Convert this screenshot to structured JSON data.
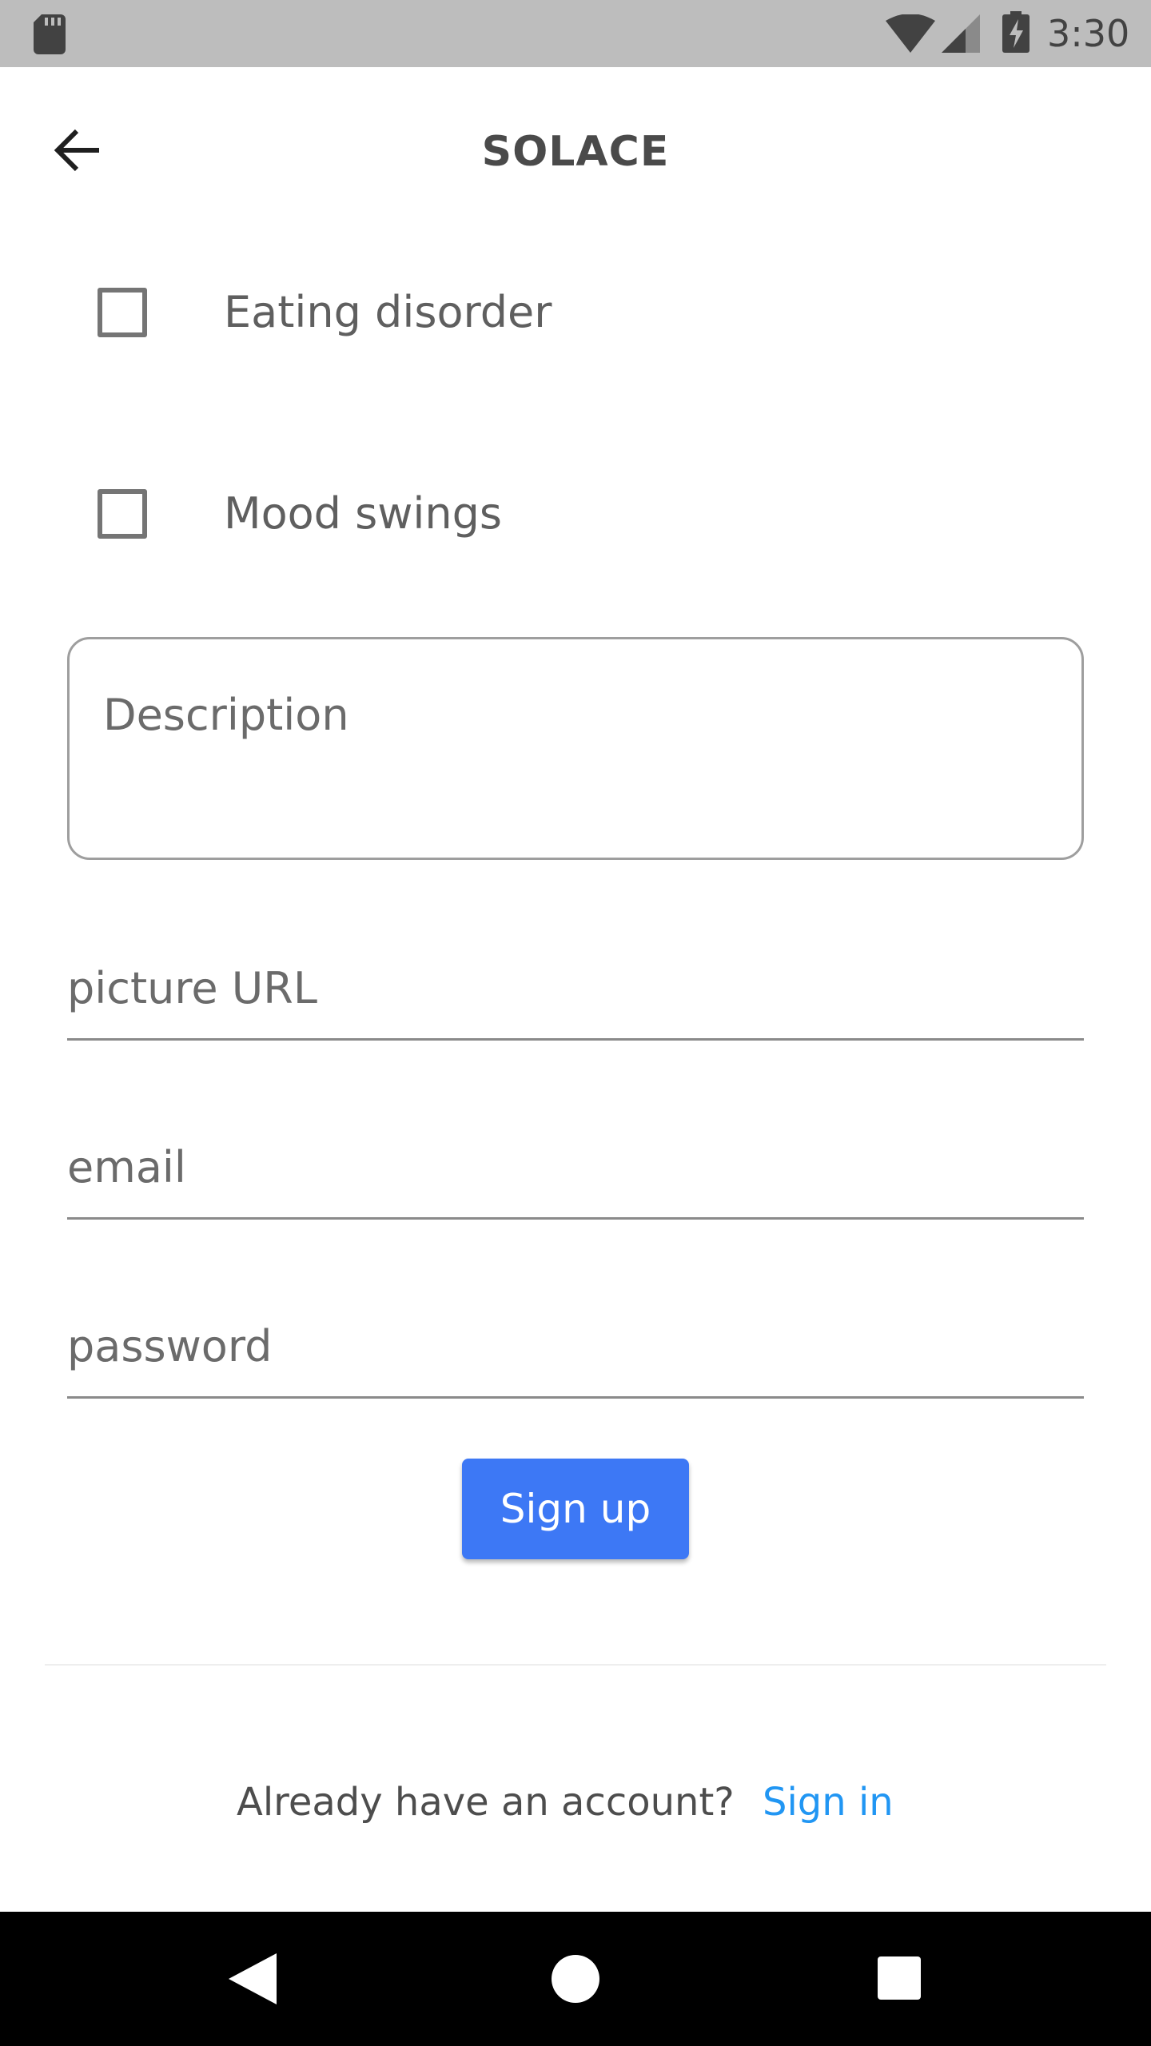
{
  "status_bar": {
    "time": "3:30",
    "icons": [
      "sd-card-icon",
      "wifi-icon",
      "signal-icon",
      "battery-charging-icon"
    ],
    "background": "#bdbdbd"
  },
  "app_bar": {
    "title": "SOLACE",
    "back_icon": "arrow-left-icon"
  },
  "checkboxes": [
    {
      "label": "Eating disorder",
      "checked": false
    },
    {
      "label": "Mood swings",
      "checked": false
    }
  ],
  "form": {
    "description_placeholder": "Description",
    "picture_url_placeholder": "picture URL",
    "email_placeholder": "email",
    "password_placeholder": "password",
    "submit_label": "Sign up",
    "submit_color": "#3d78f5"
  },
  "footer": {
    "prompt": "Already have an account?",
    "link": "Sign in",
    "link_color": "#2196f3"
  },
  "nav_bar": {
    "icons": [
      "nav-back-icon",
      "nav-home-icon",
      "nav-recents-icon"
    ]
  }
}
